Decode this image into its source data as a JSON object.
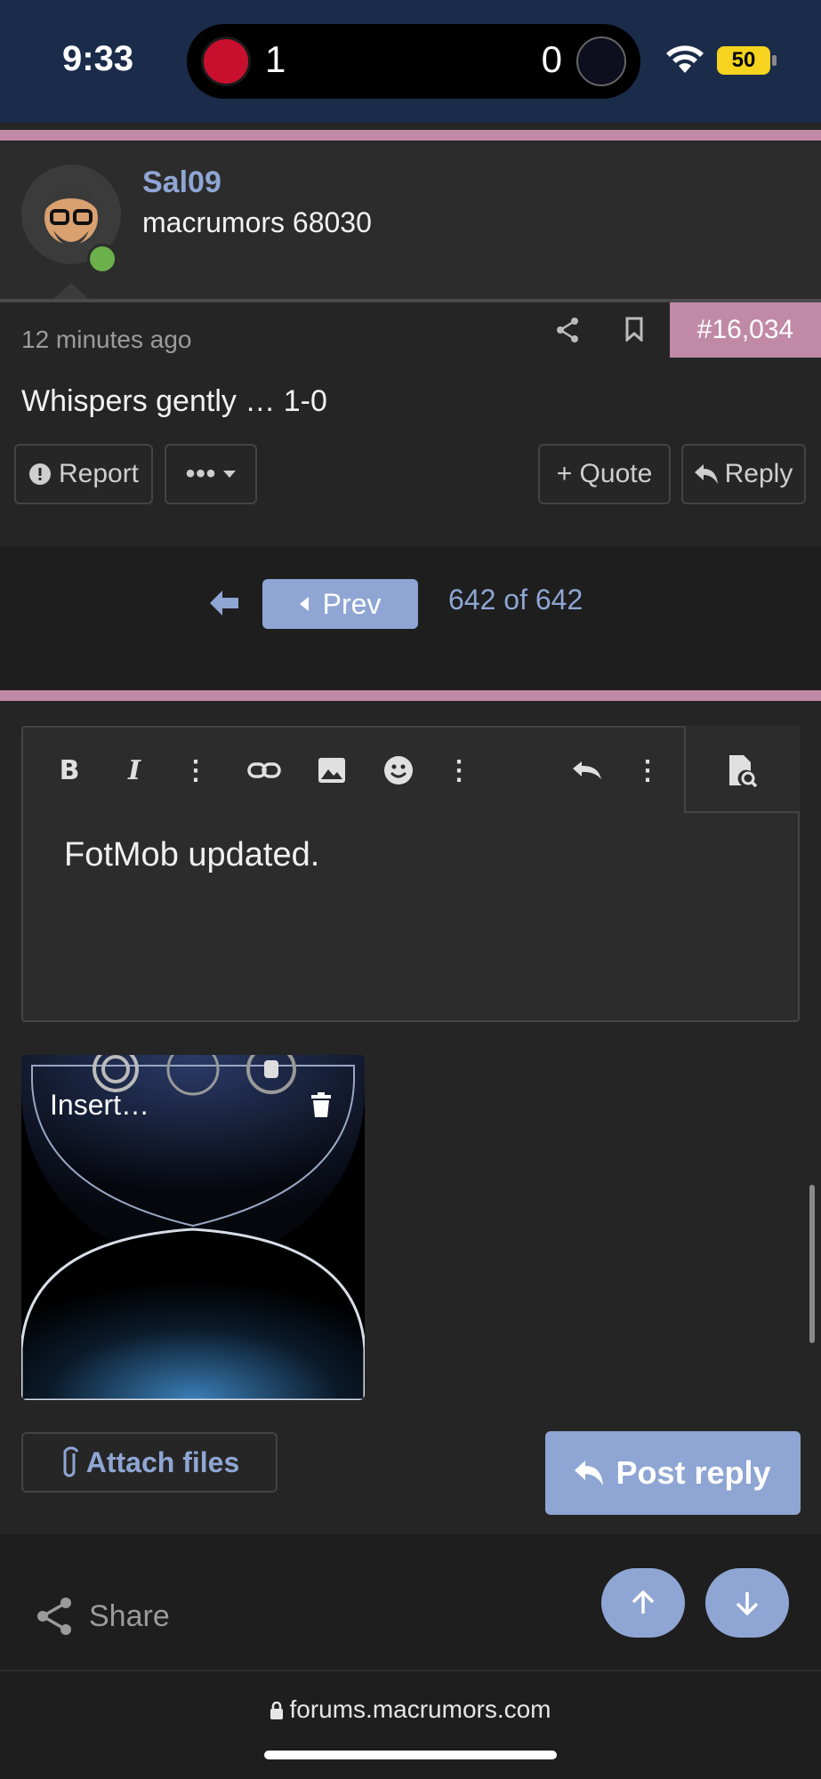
{
  "status_bar": {
    "time": "9:33",
    "score_home": "1",
    "score_away": "0",
    "battery": "50",
    "home_team_icon": "manchester-united-crest",
    "away_team_icon": "tottenham-crest"
  },
  "post": {
    "username": "Sal09",
    "user_title": "macrumors 68030",
    "timestamp": "12 minutes ago",
    "post_number": "#16,034",
    "text": "Whispers gently … 1-0",
    "actions": {
      "report": "Report",
      "more": "•••",
      "quote": "+ Quote",
      "reply": "Reply"
    }
  },
  "pagination": {
    "prev": "Prev",
    "info": "642 of 642"
  },
  "editor": {
    "content": "FotMob updated.",
    "attachment_label": "Insert…"
  },
  "actions": {
    "attach_files": "Attach files",
    "post_reply": "Post reply"
  },
  "footer": {
    "share": "Share",
    "url": "forums.macrumors.com"
  },
  "colors": {
    "accent_blue": "#8fa6d4",
    "accent_pink": "#c08aa6",
    "status_bar": "#1b2b4a",
    "background": "#252525"
  }
}
